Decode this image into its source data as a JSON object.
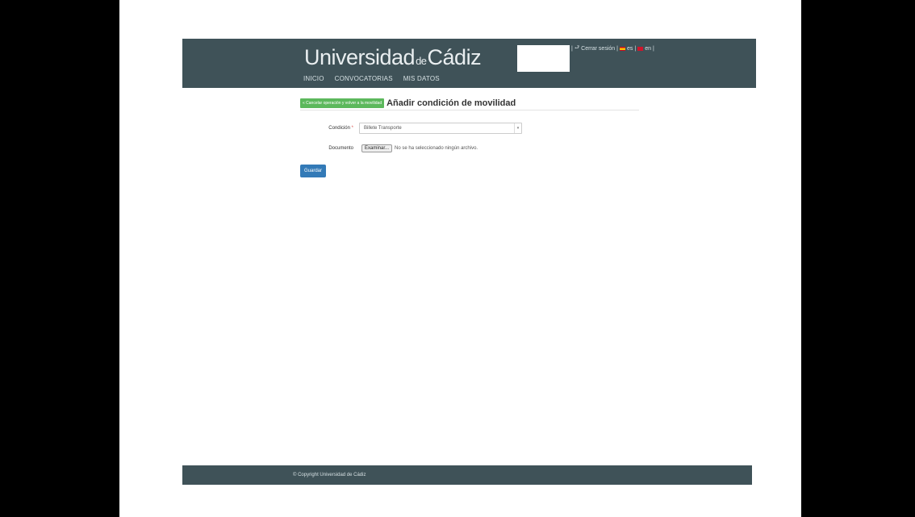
{
  "header": {
    "logo_main": "Universidad",
    "logo_de": "de",
    "logo_city": "Cádiz",
    "nav": [
      "INICIO",
      "CONVOCATORIAS",
      "MIS DATOS"
    ],
    "userbar": {
      "sep1": "| ",
      "logout_icon": "⮐",
      "logout": "Cerrar sesión",
      "sep2": " | ",
      "lang_es": "es",
      "sep3": " | ",
      "lang_en": "en",
      "sep4": " |"
    }
  },
  "form": {
    "back_label": "« Cancelar operación y volver a la movilidad",
    "title": "Añadir condición de movilidad",
    "condicion_label": "Condición",
    "required_mark": "*",
    "condicion_value": "Billete Transporte",
    "documento_label": "Documento",
    "browse_label": "Examinar...",
    "no_file": "No se ha seleccionado ningún archivo.",
    "save_label": "Guardar"
  },
  "footer": {
    "copyright": "© Copyright Universidad de Cádiz"
  },
  "colors": {
    "header_bg": "#3f5258",
    "back_btn": "#5cb85c",
    "save_btn": "#337ab7",
    "required": "#d9534f"
  }
}
